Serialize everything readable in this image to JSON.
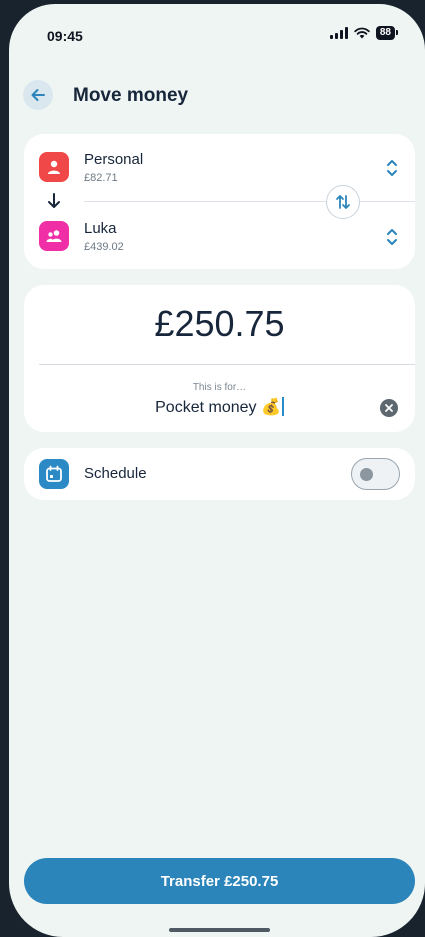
{
  "status_bar": {
    "time": "09:45",
    "battery": "88"
  },
  "header": {
    "title": "Move money"
  },
  "accounts": {
    "from": {
      "name": "Personal",
      "balance": "£82.71",
      "icon": "person-icon",
      "color": "#f04848"
    },
    "to": {
      "name": "Luka",
      "balance": "£439.02",
      "icon": "people-icon",
      "color": "#f02ea6"
    }
  },
  "amount": {
    "value": "£250.75",
    "note_label": "This is for…",
    "note_value": "Pocket money 💰"
  },
  "schedule": {
    "label": "Schedule",
    "enabled": false
  },
  "footer": {
    "transfer_label": "Transfer £250.75"
  },
  "colors": {
    "accent": "#2b85ba",
    "background": "#eff5f2",
    "card": "#ffffff"
  }
}
